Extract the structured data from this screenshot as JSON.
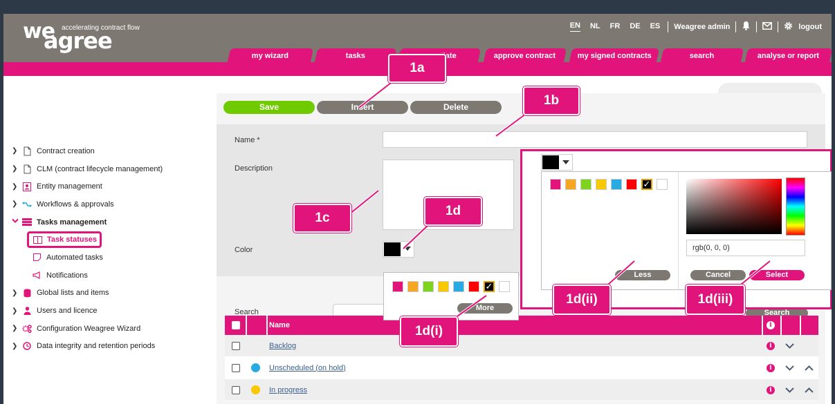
{
  "header": {
    "logo_we": "we",
    "logo_agree": "agree",
    "logo_tagline": "accelerating contract flow",
    "languages": [
      "EN",
      "NL",
      "FR",
      "DE",
      "ES"
    ],
    "active_language": "EN",
    "user": "Weagree admin",
    "logout": "logout"
  },
  "tabs": [
    "my wizard",
    "tasks",
    "negotiate",
    "approve contract",
    "my signed contracts",
    "search",
    "analyse or report"
  ],
  "sidebar": {
    "items": [
      {
        "label": "Contract creation",
        "icon": "document-icon"
      },
      {
        "label": "CLM (contract lifecycle management)",
        "icon": "document-icon"
      },
      {
        "label": "Entity management",
        "icon": "id-card-icon"
      },
      {
        "label": "Workflows & approvals",
        "icon": "workflow-icon"
      },
      {
        "label": "Tasks management",
        "icon": "tasks-icon"
      },
      {
        "label": "Task statuses",
        "icon": "columns-icon"
      },
      {
        "label": "Automated tasks",
        "icon": "note-icon"
      },
      {
        "label": "Notifications",
        "icon": "megaphone-icon"
      },
      {
        "label": "Global lists and items",
        "icon": "database-icon"
      },
      {
        "label": "Users and licence",
        "icon": "user-icon"
      },
      {
        "label": "Configuration Weagree Wizard",
        "icon": "cogs-icon"
      },
      {
        "label": "Data integrity and retention periods",
        "icon": "clock-icon"
      }
    ]
  },
  "toolbar": {
    "save": "Save",
    "insert": "Insert",
    "delete": "Delete"
  },
  "form": {
    "name_label": "Name *",
    "name_value": "",
    "description_label": "Description",
    "description_value": "",
    "color_label": "Color",
    "selected_color": "#000000"
  },
  "palette": {
    "colors": [
      "#e0147a",
      "#f5a623",
      "#7ed321",
      "#f8c800",
      "#29abe2",
      "#ff0000",
      "#000000",
      "#ffffff"
    ],
    "more": "More"
  },
  "extended_picker": {
    "rgb_value": "rgb(0, 0, 0)",
    "less": "Less",
    "cancel": "Cancel",
    "select": "Select"
  },
  "search": {
    "label": "Search",
    "button": "Search",
    "value": ""
  },
  "table": {
    "header_name": "Name",
    "rows": [
      {
        "name": "Backlog",
        "color": "#eeeeee"
      },
      {
        "name": "Unscheduled (on hold)",
        "color": "#29abe2"
      },
      {
        "name": "In progress",
        "color": "#f8c800"
      }
    ]
  },
  "callouts": {
    "c1a": "1a",
    "c1b": "1b",
    "c1c": "1c",
    "c1d": "1d",
    "c1di": "1d(i)",
    "c1dii": "1d(ii)",
    "c1diii": "1d(iii)"
  },
  "colors": {
    "brand_pink": "#e0147a",
    "header_gray": "#7e7873",
    "save_green": "#6fcb00",
    "outer_bg": "#2d3947"
  }
}
